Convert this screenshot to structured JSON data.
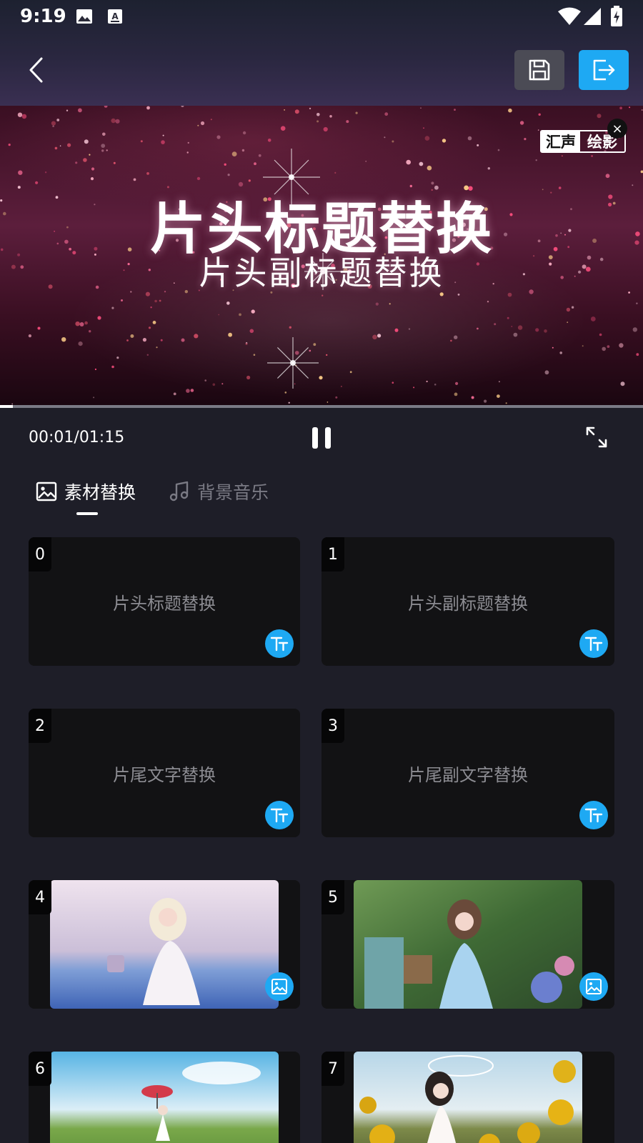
{
  "status_bar": {
    "time": "9:19",
    "icons": [
      "image-notification-icon",
      "a-notification-icon",
      "wifi-icon",
      "signal-icon",
      "battery-icon"
    ]
  },
  "toolbar": {
    "back_icon": "chevron-left-icon",
    "save_icon": "floppy-disk-icon",
    "export_icon": "export-icon",
    "accent_color": "#1ea9f3"
  },
  "preview": {
    "title": "片头标题替换",
    "subtitle": "片头副标题替换",
    "watermark_left": "汇声",
    "watermark_right": "绘影",
    "watermark_close": "×",
    "progress_fraction": 0.02
  },
  "playback": {
    "time": "00:01/01:15",
    "state": "playing"
  },
  "tabs": [
    {
      "label": "素材替换",
      "icon": "image-icon",
      "active": true
    },
    {
      "label": "背景音乐",
      "icon": "music-note-icon",
      "active": false
    }
  ],
  "items": [
    {
      "index": "0",
      "kind": "text",
      "label": "片头标题替换"
    },
    {
      "index": "1",
      "kind": "text",
      "label": "片头副标题替换"
    },
    {
      "index": "2",
      "kind": "text",
      "label": "片尾文字替换"
    },
    {
      "index": "3",
      "kind": "text",
      "label": "片尾副文字替换"
    },
    {
      "index": "4",
      "kind": "image",
      "label": ""
    },
    {
      "index": "5",
      "kind": "image",
      "label": ""
    },
    {
      "index": "6",
      "kind": "image",
      "label": ""
    },
    {
      "index": "7",
      "kind": "image",
      "label": ""
    }
  ]
}
